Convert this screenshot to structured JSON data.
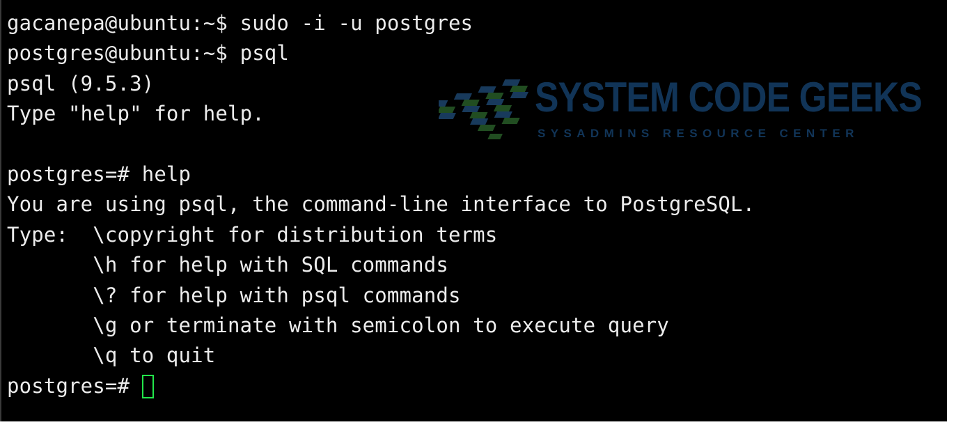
{
  "terminal": {
    "lines": [
      "gacanepa@ubuntu:~$ sudo -i -u postgres",
      "postgres@ubuntu:~$ psql",
      "psql (9.5.3)",
      "Type \"help\" for help.",
      "",
      "postgres=# help",
      "You are using psql, the command-line interface to PostgreSQL.",
      "Type:  \\copyright for distribution terms",
      "       \\h for help with SQL commands",
      "       \\? for help with psql commands",
      "       \\g or terminate with semicolon to execute query",
      "       \\q to quit"
    ],
    "prompt": "postgres=# "
  },
  "watermark": {
    "title": "SYSTEM CODE GEEKS",
    "subtitle": "SYSADMINS RESOURCE CENTER",
    "icon": "checkered-flag-logo-icon"
  },
  "colors": {
    "background": "#000000",
    "text": "#ececec",
    "cursor": "#22e64a",
    "watermark_blue": "#1f5f9e",
    "watermark_green": "#3a8a3a"
  }
}
